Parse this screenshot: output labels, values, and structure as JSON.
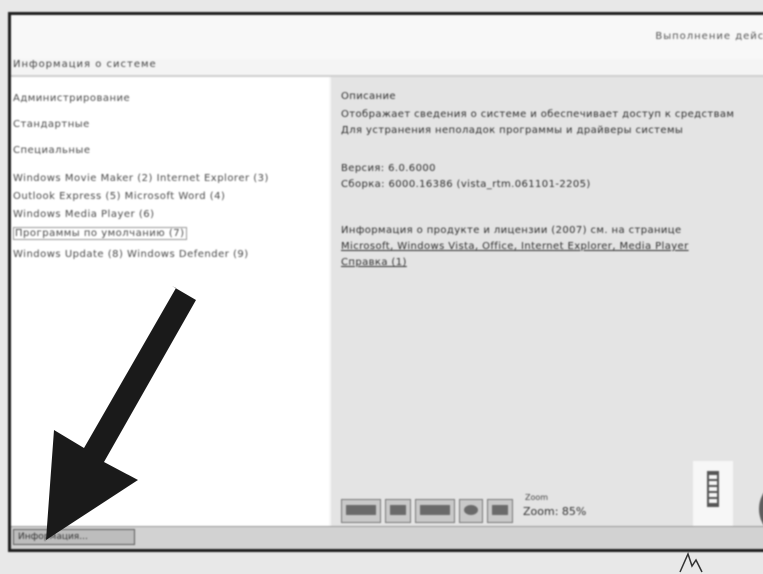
{
  "window": {
    "title": "Информация о системе",
    "top_right": "Выполнение действ"
  },
  "sidebar": {
    "items": [
      {
        "label": "Администрирование"
      },
      {
        "label": "Стандартные"
      },
      {
        "label": "Специальные"
      },
      {
        "label": "Windows Movie Maker (2) Internet Explorer (3)"
      },
      {
        "label": "Outlook Express (5) Microsoft Word (4)"
      },
      {
        "label": "Windows Media Player (6)"
      },
      {
        "label": "Программы по умолчанию (7)"
      },
      {
        "label": "Windows Update (8) Windows Defender (9)"
      }
    ]
  },
  "details": {
    "heading": "Описание",
    "line1": "Отображает сведения о системе и обеспечивает доступ к средствам",
    "line2": "Для устранения неполадок программы и драйверы системы",
    "version_label": "Версия: 6.0.6000",
    "build_label": "Сборка: 6000.16386 (vista_rtm.061101-2205)",
    "info_line": "Информация о продукте и лицензии (2007) см. на странице",
    "links": "Microsoft, Windows Vista, Office, Internet Explorer, Media Player",
    "links_tail": "Справка (1)"
  },
  "toolbar": {
    "zoom_label": "Zoom",
    "zoom_value": "Zoom: 85%"
  },
  "taskbar": {
    "start_label": "Информация..."
  },
  "colors": {
    "frame": "#1e1e1e",
    "left_pane": "#ffffff",
    "right_pane": "#e4e4e4",
    "arrow": "#1a1a1a"
  },
  "icons": {
    "arrow": "pointer-arrow-icon",
    "cursor": "mouse-cursor-icon"
  }
}
